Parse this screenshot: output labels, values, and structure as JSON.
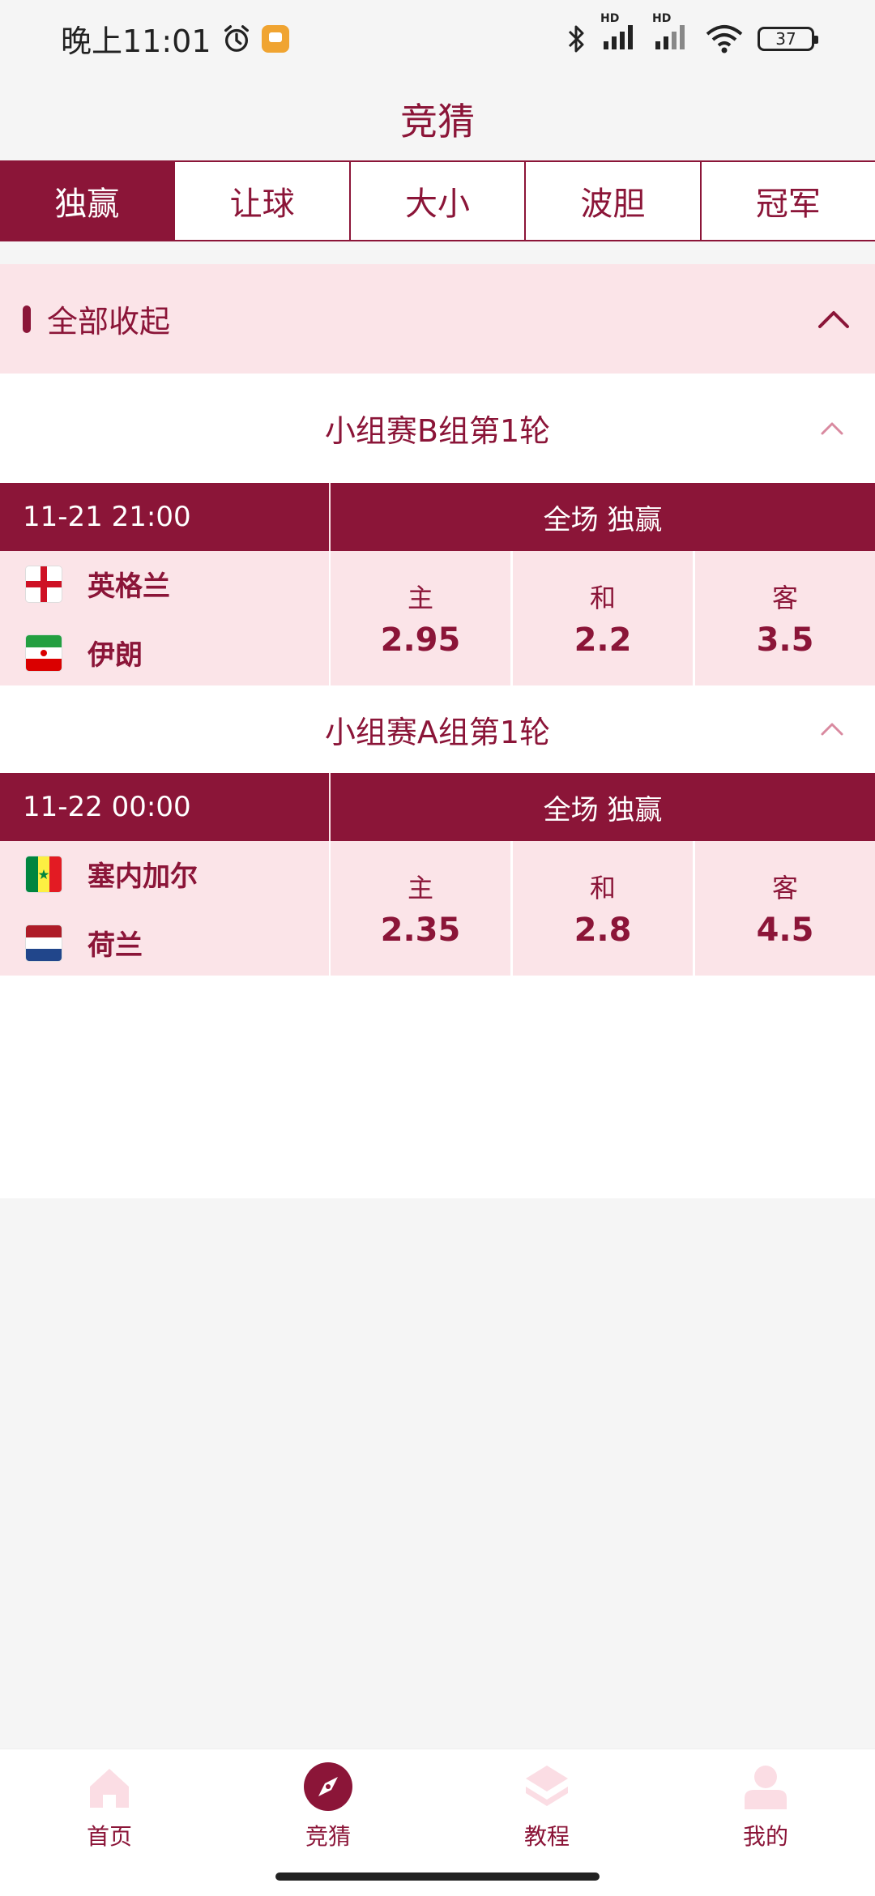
{
  "status_bar": {
    "time": "晚上11:01",
    "network_1": "HD",
    "network_2": "HD",
    "battery": "37"
  },
  "header": {
    "title": "竞猜"
  },
  "tabs": [
    {
      "label": "独赢",
      "active": true
    },
    {
      "label": "让球",
      "active": false
    },
    {
      "label": "大小",
      "active": false
    },
    {
      "label": "波胆",
      "active": false
    },
    {
      "label": "冠军",
      "active": false
    }
  ],
  "collapse_all": {
    "label": "全部收起"
  },
  "groups": [
    {
      "title": "小组赛B组第1轮",
      "match": {
        "time": "11-21 21:00",
        "market": "全场 独赢",
        "home": "英格兰",
        "away": "伊朗",
        "odds": [
          {
            "label": "主",
            "value": "2.95"
          },
          {
            "label": "和",
            "value": "2.2"
          },
          {
            "label": "客",
            "value": "3.5"
          }
        ]
      }
    },
    {
      "title": "小组赛A组第1轮",
      "match": {
        "time": "11-22 00:00",
        "market": "全场 独赢",
        "home": "塞内加尔",
        "away": "荷兰",
        "odds": [
          {
            "label": "主",
            "value": "2.35"
          },
          {
            "label": "和",
            "value": "2.8"
          },
          {
            "label": "客",
            "value": "4.5"
          }
        ]
      }
    }
  ],
  "bottom_nav": [
    {
      "label": "首页",
      "icon": "home-icon"
    },
    {
      "label": "竞猜",
      "icon": "compass-icon"
    },
    {
      "label": "教程",
      "icon": "layers-icon"
    },
    {
      "label": "我的",
      "icon": "user-icon"
    }
  ],
  "colors": {
    "brand": "#8b1538",
    "light": "#fbe4e8"
  }
}
